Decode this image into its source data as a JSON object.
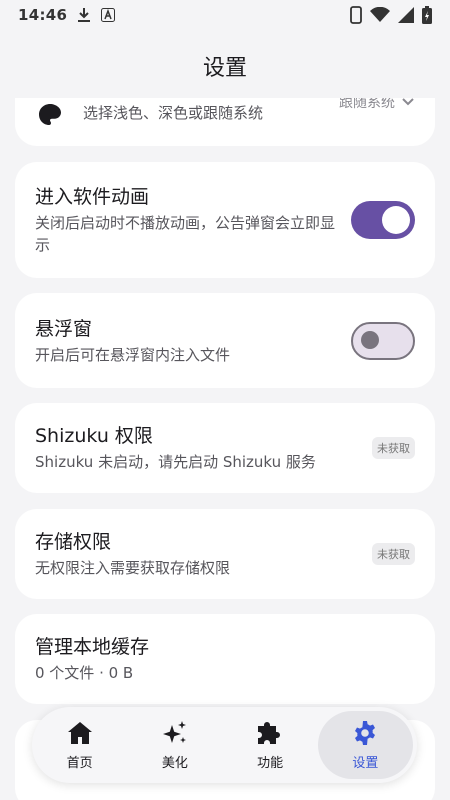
{
  "status_bar": {
    "time": "14:46"
  },
  "app_bar": {
    "title": "设置"
  },
  "theme": {
    "subtitle": "选择浅色、深色或跟随系统",
    "value": "跟随系统"
  },
  "cards": [
    {
      "title": "进入软件动画",
      "subtitle": "关闭后启动时不播放动画，公告弹窗会立即显示",
      "toggle": true
    },
    {
      "title": "悬浮窗",
      "subtitle": "开启后可在悬浮窗内注入文件",
      "toggle": false
    },
    {
      "title": "Shizuku 权限",
      "subtitle": "Shizuku 未启动，请先启动 Shizuku 服务",
      "badge": "未获取"
    },
    {
      "title": "存储权限",
      "subtitle": "无权限注入需要获取存储权限",
      "badge": "未获取"
    },
    {
      "title": "管理本地缓存",
      "subtitle": "0 个文件 · 0 B"
    }
  ],
  "nav": [
    {
      "label": "首页",
      "icon": "home-icon"
    },
    {
      "label": "美化",
      "icon": "sparkle-icon"
    },
    {
      "label": "功能",
      "icon": "puzzle-icon"
    },
    {
      "label": "设置",
      "icon": "gear-icon",
      "active": true
    }
  ],
  "colors": {
    "accent": "#6750a4",
    "nav_active": "#3a57d6",
    "background": "#f4f4f6"
  }
}
